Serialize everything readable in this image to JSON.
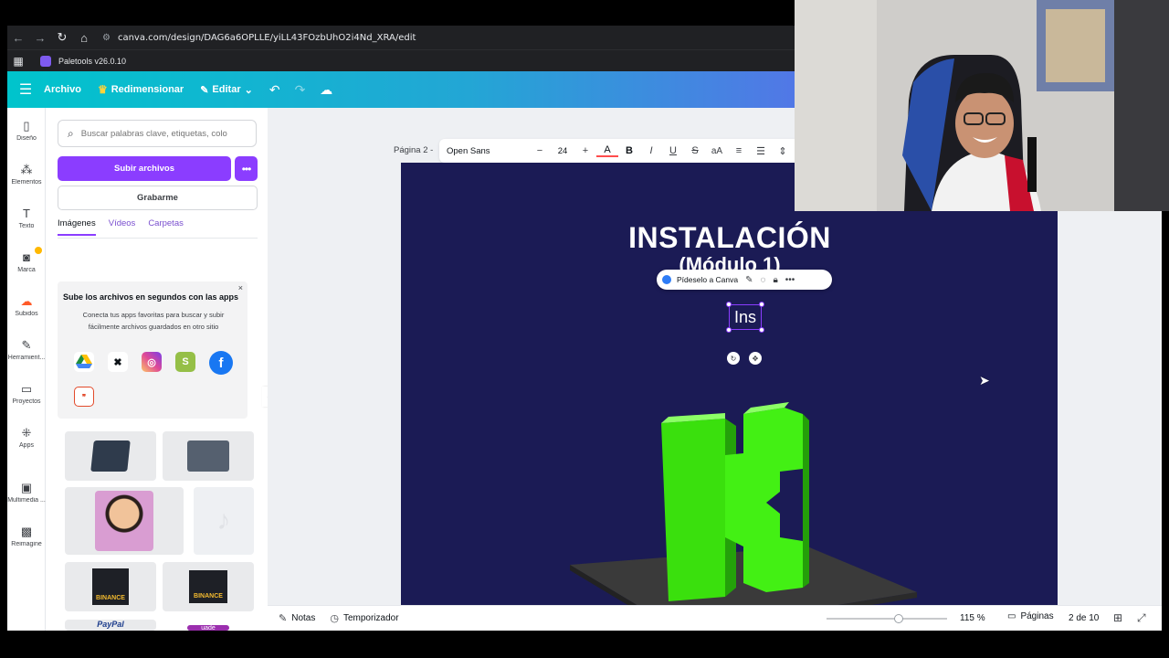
{
  "browser": {
    "url": "canva.com/design/DAG6a6OPLLE/yiLL43FOzbUhO2i4Nd_XRA/edit",
    "bookmark_label": "Paletools v26.0.10"
  },
  "header": {
    "file_label": "Archivo",
    "resize_label": "Redimensionar",
    "edit_label": "Editar"
  },
  "rail": {
    "items": [
      {
        "label": "Diseño",
        "icon": "layout-icon"
      },
      {
        "label": "Elementos",
        "icon": "shapes-icon"
      },
      {
        "label": "Texto",
        "icon": "text-icon"
      },
      {
        "label": "Marca",
        "icon": "brand-icon"
      },
      {
        "label": "Subidos",
        "icon": "upload-icon"
      },
      {
        "label": "Herramient...",
        "icon": "tools-icon"
      },
      {
        "label": "Proyectos",
        "icon": "folder-icon"
      },
      {
        "label": "Apps",
        "icon": "apps-icon"
      },
      {
        "label": "Multimedia ...",
        "icon": "media-icon"
      },
      {
        "label": "Reimagine",
        "icon": "reimagine-icon"
      }
    ]
  },
  "panel": {
    "search_placeholder": "Buscar palabras clave, etiquetas, colo",
    "upload_label": "Subir archivos",
    "record_label": "Grabarme",
    "tabs": [
      "Imágenes",
      "Vídeos",
      "Carpetas"
    ],
    "promo_title": "Sube los archivos en segundos con las apps",
    "promo_desc": "Conecta tus apps favoritas para buscar y subir fácilmente archivos guardados en otro sitio",
    "thumb_labels": [
      "BINANCE",
      "BINANCE",
      "PayPal",
      "uade"
    ]
  },
  "toolbar": {
    "page_label": "Página 2 -",
    "font": "Open Sans",
    "font_size": "24"
  },
  "slide": {
    "title": "INSTALACIÓN",
    "subtitle": "(Módulo 1)",
    "ask_canva": "Pídeselo a Canva",
    "selected_text": "Ins"
  },
  "bottom": {
    "notes_label": "Notas",
    "timer_label": "Temporizador",
    "zoom": "115 %",
    "zoom_fraction": 0.6,
    "pages_label": "Páginas",
    "page_count": "2 de 10"
  },
  "colors": {
    "canvas_bg": "#1b1b55",
    "accent_purple": "#8b3dff",
    "k_green": "#39e60a"
  }
}
